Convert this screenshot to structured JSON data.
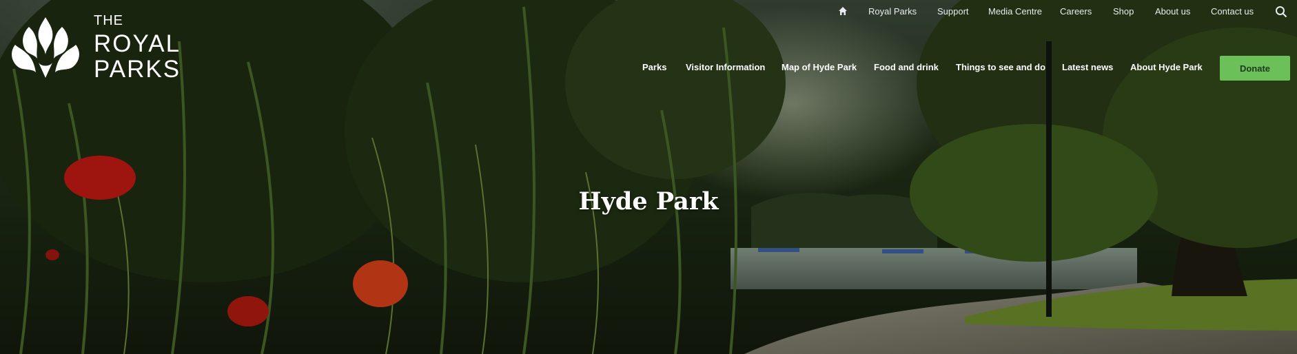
{
  "logo": {
    "line1": "THE",
    "line2": "ROYAL",
    "line3": "PARKS"
  },
  "utility_nav": {
    "items": [
      "Royal Parks",
      "Support",
      "Media Centre",
      "Careers",
      "Shop",
      "About us",
      "Contact us"
    ],
    "icons": {
      "home": "home-icon",
      "search": "search-icon"
    }
  },
  "main_nav": {
    "items": [
      "Parks",
      "Visitor Information",
      "Map of Hyde Park",
      "Food and drink",
      "Things to see and do",
      "Latest news",
      "About Hyde Park"
    ],
    "donate_label": "Donate"
  },
  "hero": {
    "title": "Hyde Park"
  },
  "colors": {
    "donate": "#6cc05a",
    "text": "#ffffff"
  }
}
